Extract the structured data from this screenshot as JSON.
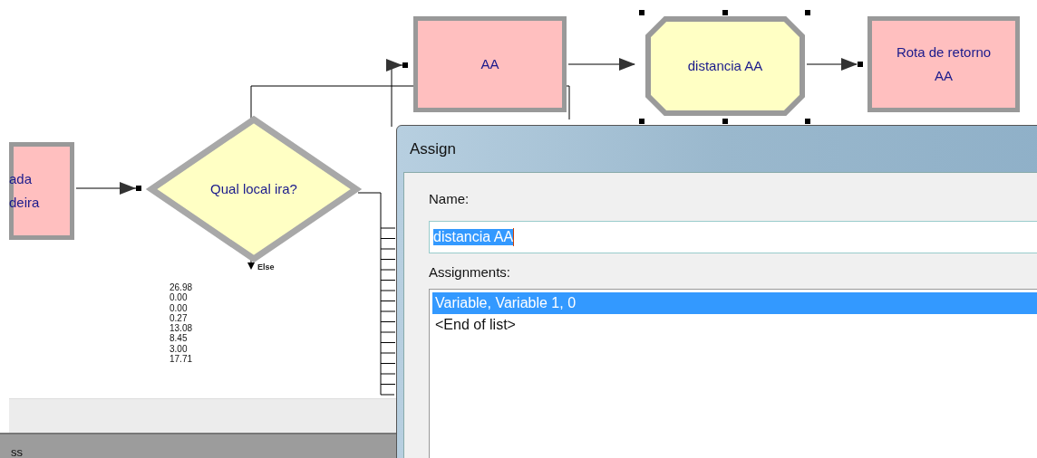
{
  "modules": [
    {
      "kind": "rect",
      "label": "ada\ndeira",
      "selected": false
    },
    {
      "kind": "diamond",
      "label": "Qual local ira?",
      "selected": false
    },
    {
      "kind": "rect",
      "label": "AA",
      "selected": false
    },
    {
      "kind": "octagon",
      "label": "distancia AA",
      "selected": true
    },
    {
      "kind": "rect",
      "label": "Rota de retorno\nAA",
      "selected": false
    }
  ],
  "else_label": "Else",
  "counters": [
    "26.98",
    "0.00",
    "0.00",
    "0.27",
    "13.08",
    "8.45",
    "3.00",
    "17.71"
  ],
  "status_bar": {
    "text": "ss"
  },
  "dialog": {
    "title": "Assign",
    "name_label": "Name:",
    "name_value": "distancia AA",
    "assignments_label": "Assignments:",
    "assignments": [
      {
        "text": "Variable, Variable 1, 0",
        "selected": true
      },
      {
        "text": "<End of list>",
        "selected": false
      }
    ]
  }
}
